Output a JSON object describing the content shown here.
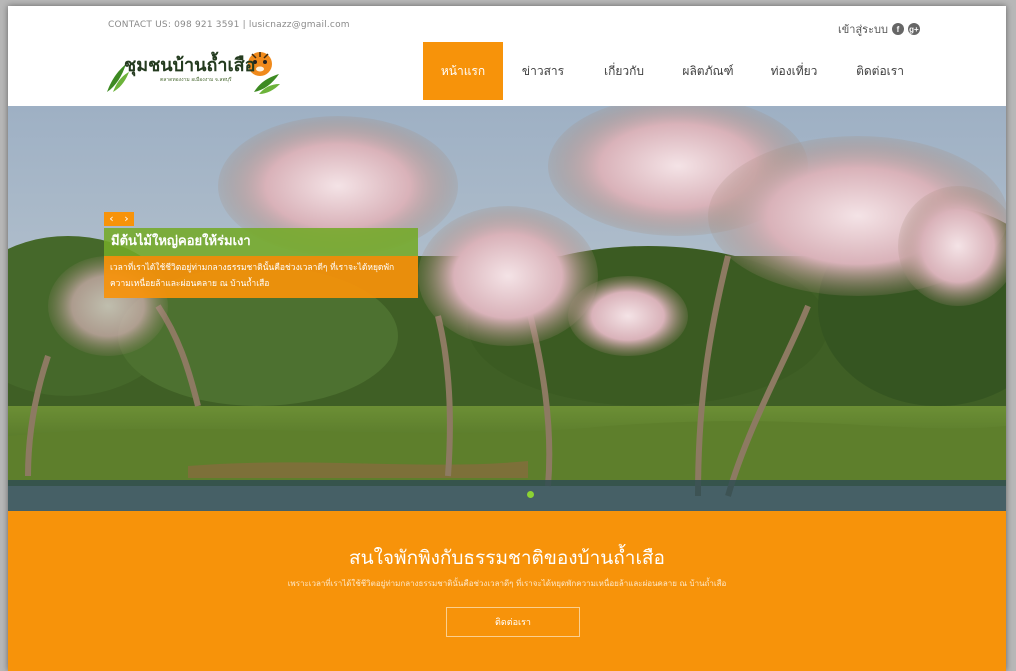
{
  "header": {
    "contact": "CONTACT US: 098 921 3591 | lusicnazz@gmail.com",
    "login_label": "เข้าสู่ระบบ",
    "social_icons": [
      "facebook-icon",
      "google-plus-icon"
    ]
  },
  "logo": {
    "title": "ชุมชนบ้านถ้ำเสือ",
    "subtitle": "ตลาดทองงาม อเมืองงาม จ.ลพบุรี"
  },
  "nav": {
    "items": [
      {
        "label": "หน้าแรก",
        "active": true
      },
      {
        "label": "ข่าวสาร",
        "active": false
      },
      {
        "label": "เกี่ยวกับ",
        "active": false
      },
      {
        "label": "ผลิตภัณฑ์",
        "active": false
      },
      {
        "label": "ท่องเที่ยว",
        "active": false
      },
      {
        "label": "ติดต่อเรา",
        "active": false
      }
    ]
  },
  "slider": {
    "prev": "‹",
    "next": "›",
    "caption_title": "มีต้นไม้ใหญ่คอยให้ร่มเงา",
    "caption_text": "เวลาที่เราได้ใช้ชีวิตอยู่ท่ามกลางธรรมชาตินั้นคือช่วงเวลาดีๆ ที่เราจะได้หยุดพักความเหนื่อยล้าและผ่อนคลาย ณ บ้านถ้ำเสือ"
  },
  "cta": {
    "title": "สนใจพักพิงกับธรรมชาติของบ้านถ้ำเสือ",
    "subtitle": "เพราะเวลาที่เราได้ใช้ชีวิตอยู่ท่ามกลางธรรมชาตินั้นคือช่วงเวลาดีๆ ที่เราจะได้หยุดพักความเหนื่อยล้าและผ่อนคลาย ณ บ้านถ้ำเสือ",
    "button": "ติดต่อเรา"
  },
  "colors": {
    "accent": "#f7930a",
    "green": "#74aa28"
  }
}
